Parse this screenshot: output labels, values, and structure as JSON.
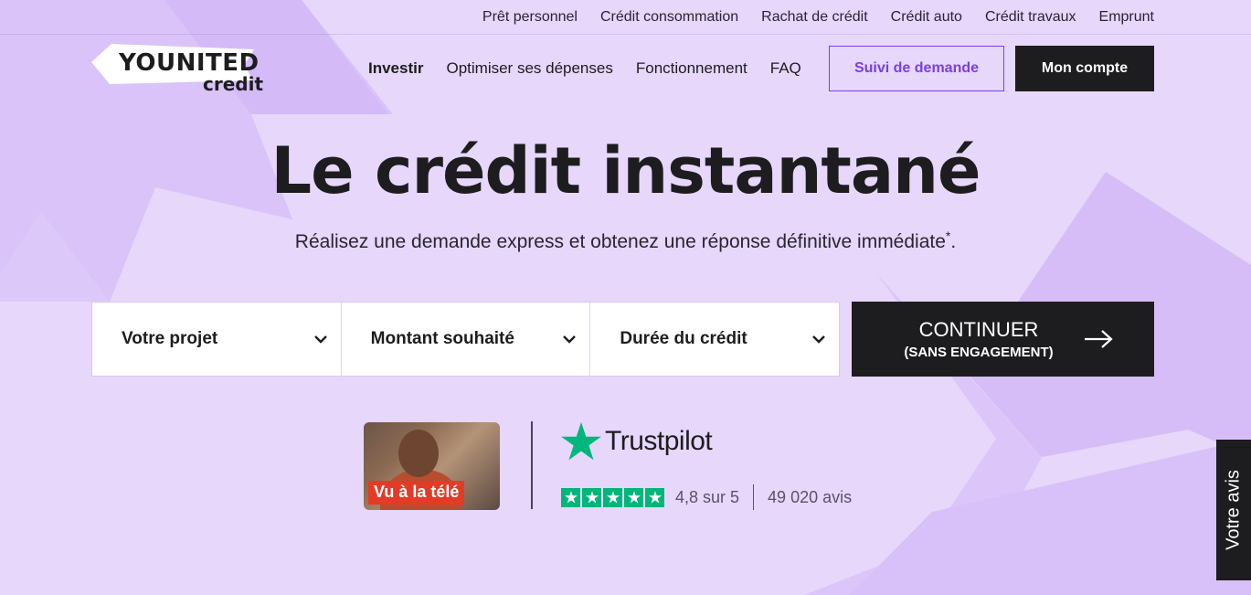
{
  "topbar": {
    "links": [
      "Prêt personnel",
      "Crédit consommation",
      "Rachat de crédit",
      "Crédit auto",
      "Crédit travaux",
      "Emprunt"
    ]
  },
  "logo": {
    "line1": "YOUNITED",
    "line2": "credit"
  },
  "nav": {
    "items": [
      "Investir",
      "Optimiser ses dépenses",
      "Fonctionnement",
      "FAQ"
    ],
    "suivi_label": "Suivi de demande",
    "compte_label": "Mon compte"
  },
  "hero": {
    "title": "Le crédit instantané",
    "subtitle": "Réalisez une demande express et obtenez une réponse définitive immédiate",
    "subtitle_mark": "*",
    "subtitle_end": "."
  },
  "form": {
    "selects": [
      "Votre projet",
      "Montant souhaité",
      "Durée du crédit"
    ],
    "cta_line1": "CONTINUER",
    "cta_line2": "(SANS ENGAGEMENT)"
  },
  "tv": {
    "label": "Vu à la télé"
  },
  "trustpilot": {
    "name": "Trustpilot",
    "score": "4,8 sur 5",
    "count": "49 020 avis",
    "stars": 5,
    "color": "#00b67a"
  },
  "feedback": {
    "label": "Votre avis"
  },
  "colors": {
    "background": "#e6d7fb",
    "accent": "#7a3fe0",
    "dark": "#1d1d1f",
    "tv_label": "#e23b26"
  },
  "icons": [
    "chevron-down-icon",
    "arrow-right-icon",
    "trustpilot-star-icon",
    "logo-flag-icon"
  ]
}
